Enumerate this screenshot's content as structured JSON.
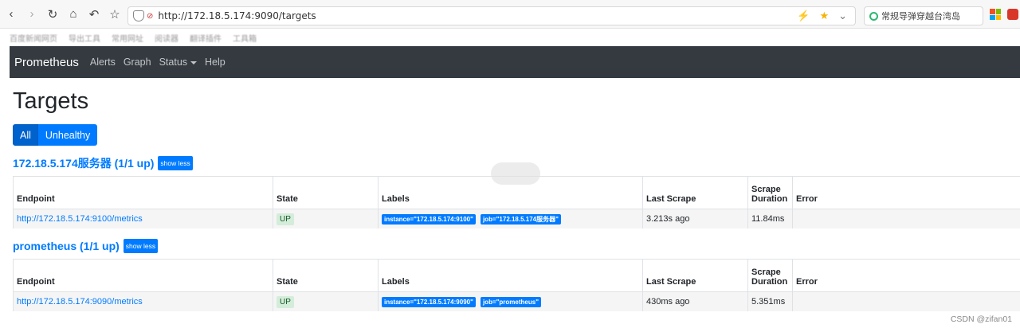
{
  "browser": {
    "url": "http://172.18.5.174:9090/targets",
    "search_text": "常规导弹穿越台湾岛",
    "bookmarks": [
      "百度新闻网页",
      "导出工具",
      "常用网址",
      "阅读器",
      "翻译插件",
      "工具箱"
    ]
  },
  "navbar": {
    "brand": "Prometheus",
    "links": [
      "Alerts",
      "Graph",
      "Status",
      "Help"
    ]
  },
  "page": {
    "title": "Targets",
    "filter_all": "All",
    "filter_unhealthy": "Unhealthy"
  },
  "table_headers": {
    "endpoint": "Endpoint",
    "state": "State",
    "labels": "Labels",
    "last_scrape": "Last Scrape",
    "scrape_duration": "Scrape Duration",
    "error": "Error"
  },
  "groups": [
    {
      "title": "172.18.5.174服务器 (1/1 up)",
      "show_less": "show less",
      "endpoint": "http://172.18.5.174:9100/metrics",
      "state": "UP",
      "label_instance": "instance=\"172.18.5.174:9100\"",
      "label_job": "job=\"172.18.5.174服务器\"",
      "last_scrape": "3.213s ago",
      "scrape_duration": "11.84ms",
      "error": ""
    },
    {
      "title": "prometheus (1/1 up)",
      "show_less": "show less",
      "endpoint": "http://172.18.5.174:9090/metrics",
      "state": "UP",
      "label_instance": "instance=\"172.18.5.174:9090\"",
      "label_job": "job=\"prometheus\"",
      "last_scrape": "430ms ago",
      "scrape_duration": "5.351ms",
      "error": ""
    }
  ],
  "watermark": "CSDN @zifan01",
  "colors": {
    "primary": "#007bff",
    "navbar": "#343a40",
    "up_bg": "#d4edda"
  }
}
